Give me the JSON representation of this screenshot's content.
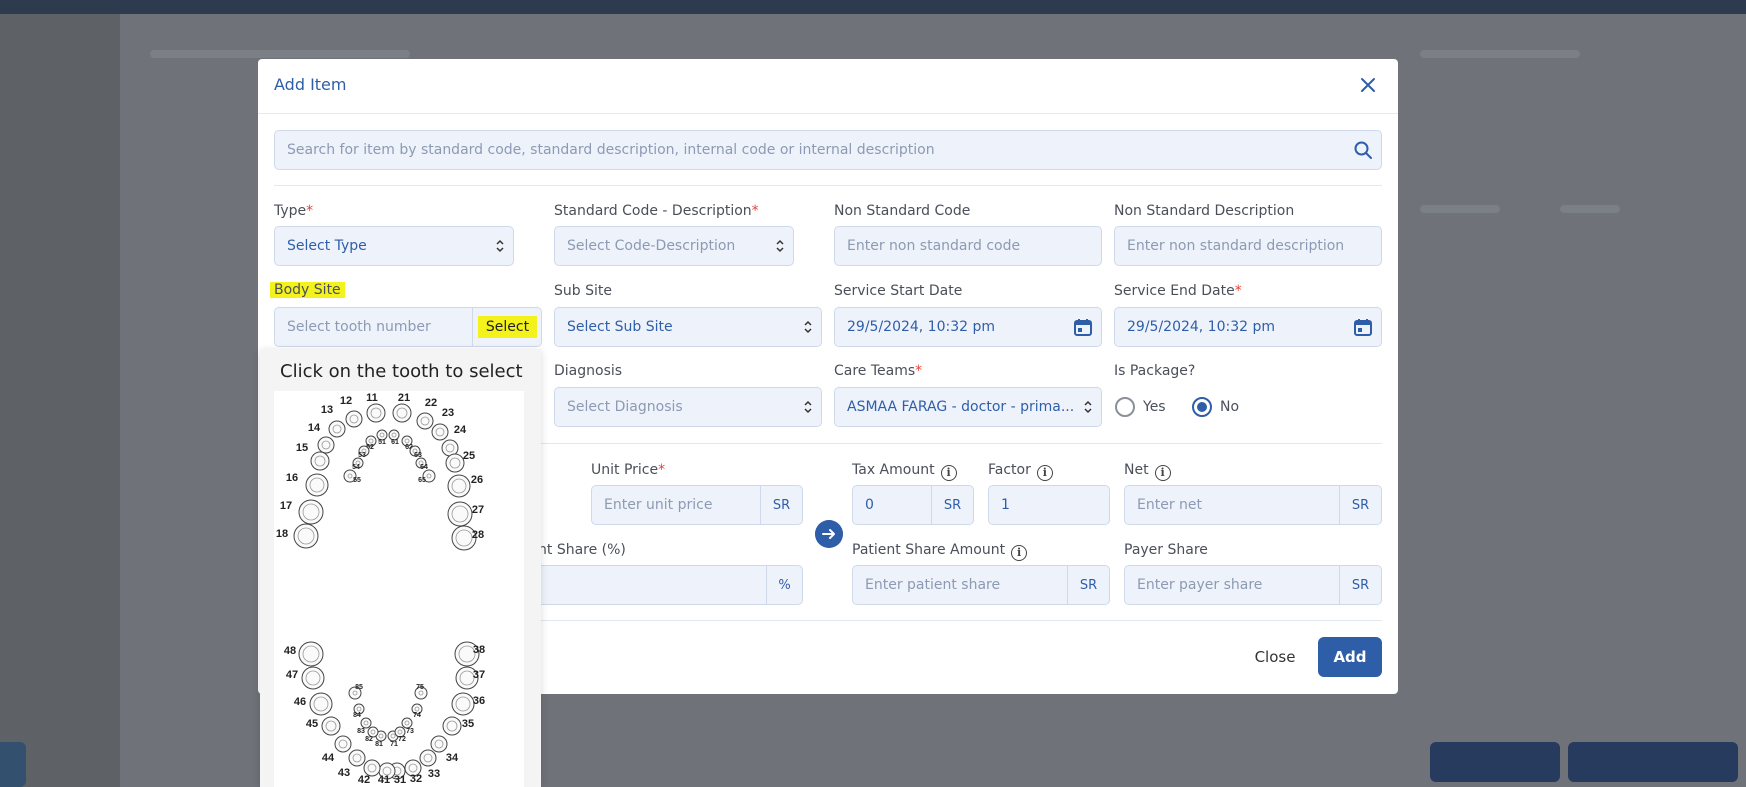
{
  "modal": {
    "title": "Add Item",
    "search_placeholder": "Search for item by standard code, standard description, internal code or internal description"
  },
  "fields": {
    "type": {
      "label": "Type",
      "value": "Select Type"
    },
    "standard_code": {
      "label": "Standard Code - Description",
      "placeholder": "Select Code-Description"
    },
    "non_standard_code": {
      "label": "Non Standard Code",
      "placeholder": "Enter non standard code"
    },
    "non_standard_description": {
      "label": "Non Standard Description",
      "placeholder": "Enter non standard description"
    },
    "body_site": {
      "label": "Body Site",
      "placeholder": "Select tooth number",
      "button": "Select"
    },
    "sub_site": {
      "label": "Sub Site",
      "value": "Select Sub Site"
    },
    "service_start_date": {
      "label": "Service Start Date",
      "value": "29/5/2024, 10:32 pm"
    },
    "service_end_date": {
      "label": "Service End Date",
      "value": "29/5/2024, 10:32 pm"
    },
    "diagnosis": {
      "label": "Diagnosis",
      "placeholder": "Select Diagnosis"
    },
    "care_teams": {
      "label": "Care Teams",
      "value": "ASMAA FARAG - doctor - prima..."
    },
    "is_package": {
      "label": "Is Package?",
      "options": [
        "Yes",
        "No"
      ],
      "selected": "No"
    },
    "unit_price": {
      "label": "Unit Price",
      "placeholder": "Enter unit price",
      "unit": "SR"
    },
    "tax_amount": {
      "label": "Tax Amount",
      "value": "0",
      "unit": "SR"
    },
    "factor": {
      "label": "Factor",
      "value": "1"
    },
    "net": {
      "label": "Net",
      "placeholder": "Enter net",
      "unit": "SR"
    },
    "patient_share_pct": {
      "label_fragment": "nt Share (%)",
      "unit": "%"
    },
    "patient_share_amount": {
      "label": "Patient Share Amount",
      "placeholder": "Enter patient share",
      "unit": "SR"
    },
    "payer_share": {
      "label": "Payer Share",
      "placeholder": "Enter payer share",
      "unit": "SR"
    }
  },
  "buttons": {
    "close": "Close",
    "add": "Add"
  },
  "tooth_selector": {
    "title": "Click on the tooth to select",
    "upper_numbers": [
      "11",
      "12",
      "13",
      "14",
      "15",
      "16",
      "17",
      "18",
      "21",
      "22",
      "23",
      "24",
      "25",
      "26",
      "27",
      "28",
      "51",
      "52",
      "53",
      "54",
      "55",
      "61",
      "62",
      "63",
      "64",
      "65"
    ],
    "lower_numbers": [
      "31",
      "32",
      "33",
      "34",
      "35",
      "36",
      "37",
      "38",
      "41",
      "42",
      "43",
      "44",
      "45",
      "46",
      "47",
      "48",
      "71",
      "72",
      "73",
      "74",
      "75",
      "81",
      "82",
      "83",
      "84",
      "85"
    ]
  },
  "colors": {
    "accent": "#2f5ea8",
    "required": "#e0443a",
    "highlight": "#f4f21c",
    "field_bg": "#eef3fb"
  },
  "icons": [
    "close-icon",
    "search-icon",
    "chevron-updown-icon",
    "calendar-icon",
    "info-icon",
    "arrow-right-icon"
  ]
}
